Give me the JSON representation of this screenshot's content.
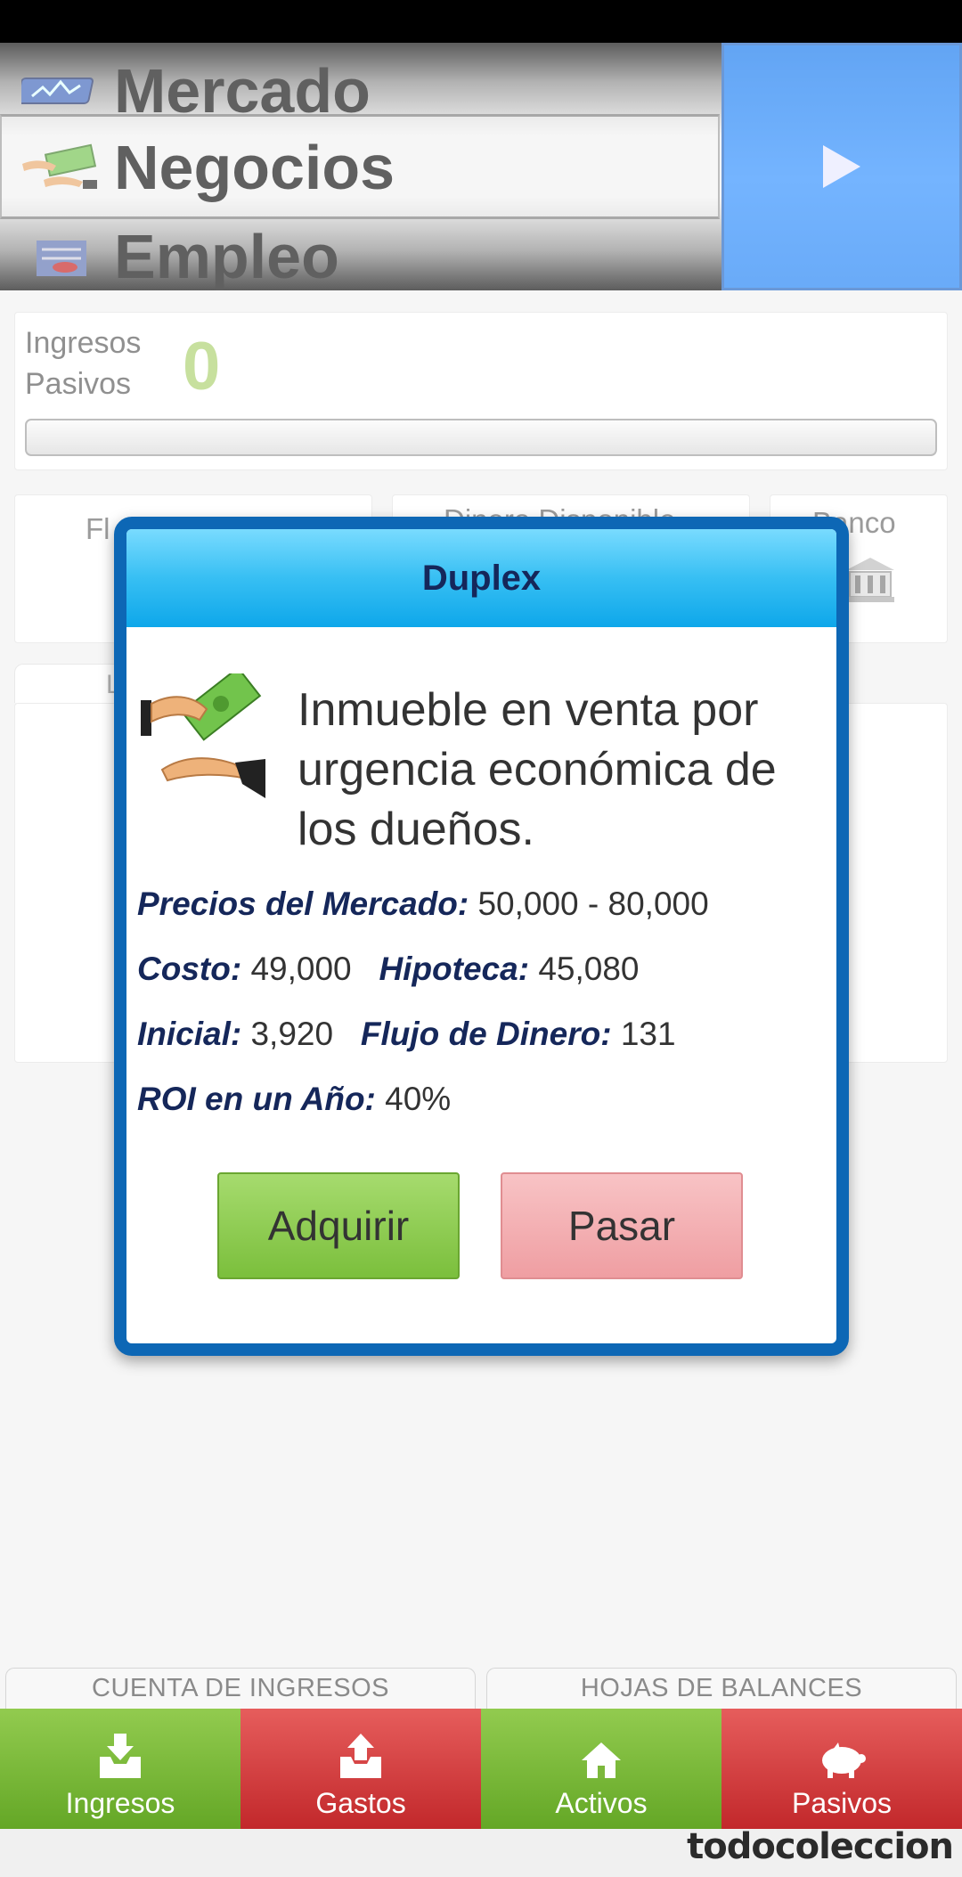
{
  "picker": {
    "items": [
      "Mercado",
      "Negocios",
      "Empleo"
    ]
  },
  "income": {
    "label_line1": "Ingresos",
    "label_line2": "Pasivos",
    "value": "0",
    "progress": 0
  },
  "stats": {
    "flujo_partial": "Fl",
    "dinero_partial": "Dinero Disponible",
    "banco_partial": "Banco",
    "tab_partial": "L"
  },
  "dialog": {
    "title": "Duplex",
    "description": "Inmueble en venta por urgencia económica de los dueños.",
    "market_label": "Precios del Mercado:",
    "market_value": "50,000 - 80,000",
    "cost_label": "Costo:",
    "cost_value": "49,000",
    "mortgage_label": "Hipoteca:",
    "mortgage_value": "45,080",
    "down_label": "Inicial:",
    "down_value": "3,920",
    "cashflow_label": "Flujo de Dinero:",
    "cashflow_value": "131",
    "roi_label": "ROI en un Año:",
    "roi_value": "40%",
    "buy_label": "Adquirir",
    "pass_label": "Pasar"
  },
  "sections": {
    "left": "CUENTA DE INGRESOS",
    "right": "HOJAS DE BALANCES"
  },
  "nav": {
    "ingresos": "Ingresos",
    "gastos": "Gastos",
    "activos": "Activos",
    "pasivos": "Pasivos"
  },
  "colors": {
    "accent_blue": "#0d67b5",
    "green": "#7bbf3c",
    "red": "#c2282b"
  },
  "watermark": "todocoleccion"
}
